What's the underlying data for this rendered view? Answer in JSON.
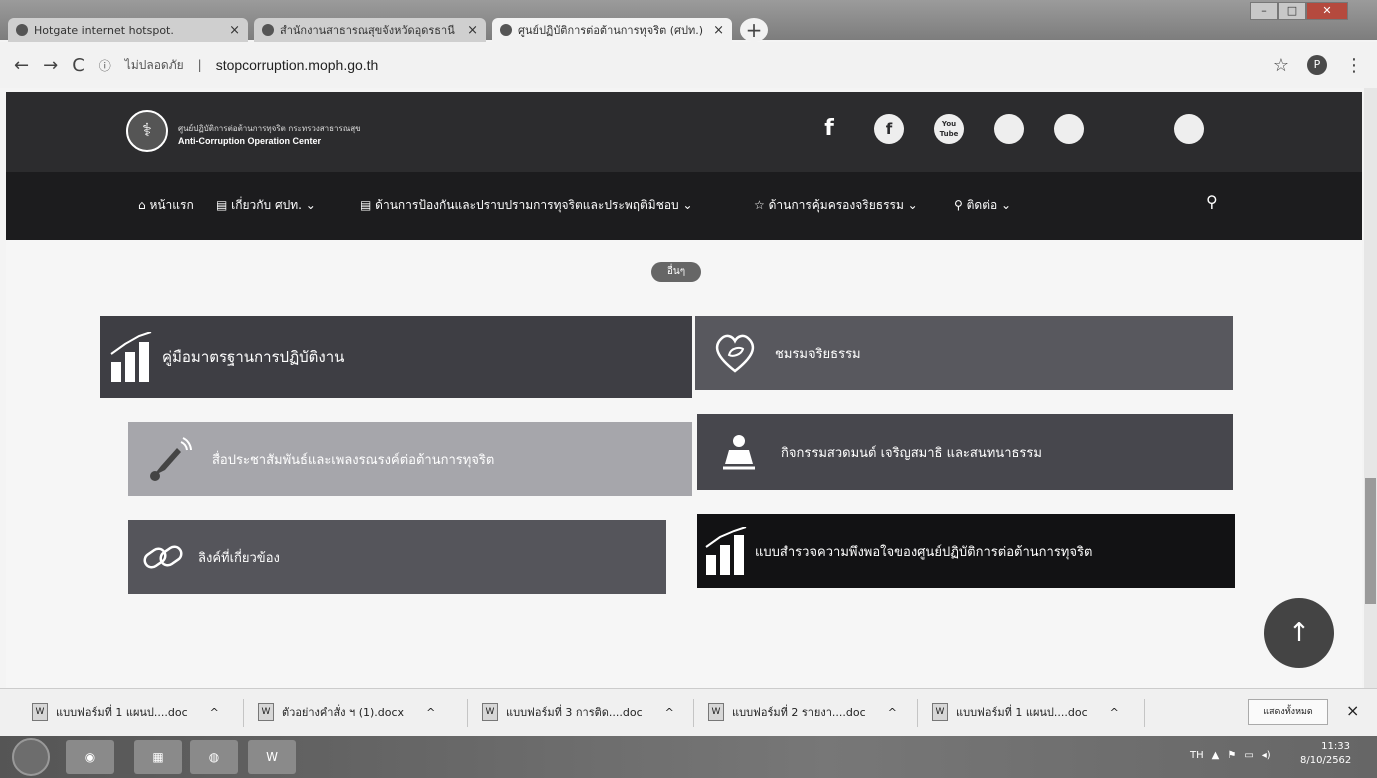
{
  "browser": {
    "tabs": [
      {
        "title": "Hotgate internet hotspot.",
        "active": false
      },
      {
        "title": "สำนักงานสาธารณสุขจังหวัดอุดรธานี",
        "active": false
      },
      {
        "title": "ศูนย์ปฏิบัติการต่อต้านการทุจริต (ศปท.)",
        "active": true
      }
    ],
    "close_glyph": "×",
    "new_tab_glyph": "+",
    "security_label": "ไม่ปลอดภัย",
    "url": "stopcorruption.moph.go.th",
    "profile_initial": "P"
  },
  "site": {
    "logo_line1": "ศูนย์ปฏิบัติการต่อต้านการทุจริต กระทรวงสาธารณสุข",
    "logo_line2": "Anti-Corruption Operation Center",
    "social": [
      "f",
      "f",
      "You Tube",
      "",
      "",
      "",
      ""
    ],
    "nav": [
      {
        "label": "หน้าแรก"
      },
      {
        "label": "เกี่ยวกับ ศปท. ⌄"
      },
      {
        "label": "ด้านการป้องกันและปราบปรามการทุจริตและประพฤติมิชอบ ⌄"
      },
      {
        "label": "ด้านการคุ้มครองจริยธรรม ⌄"
      },
      {
        "label": "ติดต่อ ⌄"
      }
    ],
    "tag": "อื่นๆ",
    "cards": [
      {
        "label": "คู่มือมาตรฐานการปฏิบัติงาน"
      },
      {
        "label": "ชมรมจริยธรรม"
      },
      {
        "label": "สื่อประชาสัมพันธ์และเพลงรณรงค์ต่อต้านการทุจริต"
      },
      {
        "label": "กิจกรรมสวดมนต์ เจริญสมาธิ และสนทนาธรรม"
      },
      {
        "label": "ลิงค์ที่เกี่ยวข้อง"
      },
      {
        "label": "แบบสำรวจความพึงพอใจของศูนย์ปฏิบัติการต่อต้านการทุจริต"
      }
    ],
    "scroll_top_glyph": "↑"
  },
  "downloads": {
    "items": [
      {
        "name": "แบบฟอร์มที่ 1 แผนป....doc"
      },
      {
        "name": "ตัวอย่างคำสั่ง ฯ (1).docx"
      },
      {
        "name": "แบบฟอร์มที่ 3 การติด....doc"
      },
      {
        "name": "แบบฟอร์มที่ 2 รายงา....doc"
      },
      {
        "name": "แบบฟอร์มที่ 1 แผนป....doc"
      }
    ],
    "show_all": "แสดงทั้งหมด",
    "close_glyph": "×"
  },
  "taskbar": {
    "lang": "TH",
    "time": "11:33",
    "date": "8/10/2562"
  }
}
